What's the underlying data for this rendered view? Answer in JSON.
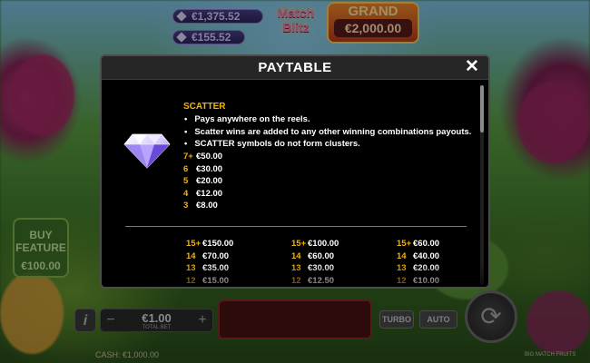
{
  "background": {
    "jackpots": [
      {
        "value": "€1,375.52"
      },
      {
        "value": "€155.52"
      }
    ],
    "logo_line1": "Match",
    "logo_line2": "Blitz",
    "grand_label": "GRAND",
    "grand_value": "€2,000.00",
    "buy_feature_label": "BUY FEATURE",
    "buy_feature_price": "€100.00",
    "bet_value": "€1.00",
    "bet_label": "TOTAL BET",
    "turbo_label": "TURBO",
    "auto_label": "AUTO",
    "cash_label": "CASH: €1,000.00",
    "game_name": "BIG MATCH FRUITS"
  },
  "modal": {
    "title": "PAYTABLE",
    "close_icon": "close-icon",
    "scatter": {
      "title": "SCATTER",
      "icon": "diamond-icon",
      "bullets": [
        "Pays anywhere on the reels.",
        "Scatter wins are added to any other winning combinations payouts.",
        "SCATTER symbols do not form clusters."
      ],
      "payouts": [
        {
          "count": "7+",
          "amount": "€50.00"
        },
        {
          "count": "6",
          "amount": "€30.00"
        },
        {
          "count": "5",
          "amount": "€20.00"
        },
        {
          "count": "4",
          "amount": "€12.00"
        },
        {
          "count": "3",
          "amount": "€8.00"
        }
      ]
    },
    "symbol_columns": [
      [
        {
          "count": "15+",
          "amount": "€150.00"
        },
        {
          "count": "14",
          "amount": "€70.00"
        },
        {
          "count": "13",
          "amount": "€35.00"
        },
        {
          "count": "12",
          "amount": "€15.00"
        }
      ],
      [
        {
          "count": "15+",
          "amount": "€100.00"
        },
        {
          "count": "14",
          "amount": "€60.00"
        },
        {
          "count": "13",
          "amount": "€30.00"
        },
        {
          "count": "12",
          "amount": "€12.50"
        }
      ],
      [
        {
          "count": "15+",
          "amount": "€60.00"
        },
        {
          "count": "14",
          "amount": "€40.00"
        },
        {
          "count": "13",
          "amount": "€20.00"
        },
        {
          "count": "12",
          "amount": "€10.00"
        }
      ]
    ]
  }
}
